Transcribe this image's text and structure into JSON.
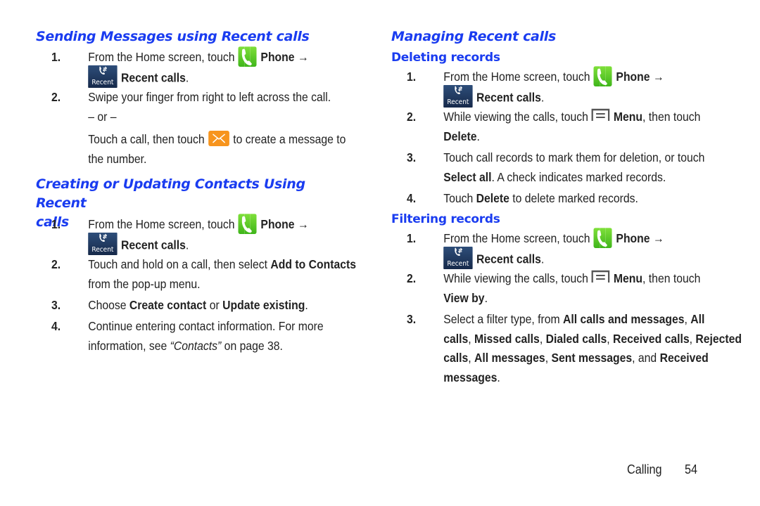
{
  "page": {
    "footer_section": "Calling",
    "footer_page": "54"
  },
  "left": {
    "sending": {
      "title": "Sending Messages using Recent calls",
      "steps": [
        {
          "num": "1.",
          "pre": "From the Home screen, touch",
          "phone": "Phone →",
          "recent": "Recent calls",
          "end": "."
        },
        {
          "num": "2.",
          "text": "Swipe your finger from right to left across the call.",
          "or": "– or –",
          "alt_pre": "Touch a call, then touch",
          "alt_post": "to create a message to",
          "alt_line2": "the number."
        }
      ]
    },
    "creating": {
      "title_line1": "Creating or Updating Contacts Using Recent",
      "title_line2": "calls",
      "steps": [
        {
          "num": "1.",
          "pre": "From the Home screen, touch",
          "phone": "Phone →",
          "recent": "Recent calls",
          "end": "."
        },
        {
          "num": "2.",
          "pre": "Touch and hold on a call, then select",
          "bold": "Add to Contacts",
          "line2": "from the pop-up menu."
        },
        {
          "num": "3.",
          "pre": "Choose",
          "bold1": "Create contact",
          "mid": "or",
          "bold2": "Update existing",
          "end": "."
        },
        {
          "num": "4.",
          "line1": "Continue entering contact information. For more",
          "pre2": "information, see",
          "ref": "“Contacts”",
          "post2": "on page 38."
        }
      ]
    }
  },
  "right": {
    "title": "Managing Recent calls",
    "deleting": {
      "title": "Deleting records",
      "steps": [
        {
          "num": "1.",
          "pre": "From the Home screen, touch",
          "phone": "Phone →",
          "recent": "Recent calls",
          "end": "."
        },
        {
          "num": "2.",
          "pre": "While viewing the calls, touch",
          "menu": "Menu",
          "post": ", then touch",
          "bold2": "Delete",
          "end": "."
        },
        {
          "num": "3.",
          "line1": "Touch call records to mark them for deletion, or touch",
          "bold": "Select all",
          "post": ". A check indicates marked records."
        },
        {
          "num": "4.",
          "pre": "Touch",
          "bold": "Delete",
          "post": "to delete marked records."
        }
      ]
    },
    "filtering": {
      "title": "Filtering records",
      "steps": [
        {
          "num": "1.",
          "pre": "From the Home screen, touch",
          "phone": "Phone →",
          "recent": "Recent calls",
          "end": "."
        },
        {
          "num": "2.",
          "pre": "While viewing the calls, touch",
          "menu": "Menu",
          "post": ", then touch",
          "bold2": "View by",
          "end": "."
        },
        {
          "num": "3.",
          "pre": "Select a filter type, from",
          "options": [
            "All calls and messages",
            "All calls",
            "Missed calls",
            "Dialed calls",
            "Received calls",
            "Rejected calls",
            "All messages",
            "Sent messages",
            "Received messages"
          ],
          "and": "and"
        }
      ]
    }
  },
  "icons": {
    "phone": "phone-app-icon",
    "recent": "recent-calls-icon",
    "recent_label": "Recent",
    "mail": "message-envelope-icon",
    "menu": "menu-key-icon"
  }
}
